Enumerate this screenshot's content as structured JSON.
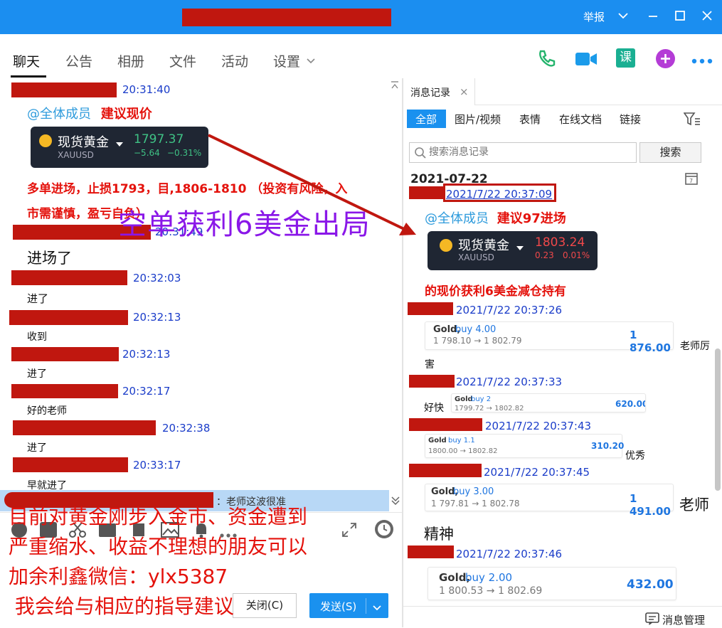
{
  "titlebar": {
    "report": "举报",
    "min": "—",
    "max": "☐",
    "close": "✕"
  },
  "tabs": [
    "聊天",
    "公告",
    "相册",
    "文件",
    "活动",
    "设置"
  ],
  "toolbar_icons": [
    "phone-icon",
    "video-icon",
    "course-icon",
    "add-icon",
    "more-icon"
  ],
  "toolbar_colors": {
    "phone": "#24b46c",
    "video": "#1b9bea",
    "course": "#1aaf92",
    "add": "#b43cd6"
  },
  "chat": {
    "m1_time": "20:31:40",
    "m1_mention": "@全体成员",
    "m1_text": "建议现价",
    "card1": {
      "name": "现货黄金",
      "symbol": "XAUUSD",
      "price": "1797.37",
      "change": "−5.64",
      "pct": "−0.31%"
    },
    "m1_line1": "多单进场，止损1793，目,1806-1810 （投资有风险，入",
    "m1_line2": "市需谨慎，盈亏自负）",
    "m2_time": "20:31:49",
    "m2_text": "进场了",
    "m3_time": "20:32:03",
    "m3_text": "进了",
    "m4_time": "20:32:13",
    "m4_text": "收到",
    "m5_time": "20:32:13",
    "m5_text": "进了",
    "m6_time": "20:32:17",
    "m6_text": "好的老师",
    "m7_time": "20:32:38",
    "m7_text": "进了",
    "m8_time": "20:33:17",
    "m8_text": "早就进了",
    "notice_sep": "：",
    "notice_text": "老师这波很准"
  },
  "overlays": {
    "purple": "空单获利6美金出局",
    "red_line1": "目前对黄金刚步入金市、资金遭到",
    "red_line2": "严重缩水、收益不理想的朋友可以",
    "red_line3": "加余利鑫微信：ylx5387",
    "red_line4": " 我会给与相应的指导建议"
  },
  "compose": {
    "close_btn": "关闭(C)",
    "send_btn": "发送(S)",
    "dropdown": "⌄"
  },
  "history": {
    "tab_title": "消息记录",
    "tab_close": "×",
    "filters": [
      "全部",
      "图片/视频",
      "表情",
      "在线文档",
      "链接"
    ],
    "search_placeholder": "搜索消息记录",
    "search_btn": "搜索",
    "date": "2021-07-22",
    "h1_time": "2021/7/22 20:37:09",
    "h1_mention": "@全体成员",
    "h1_text": "建议97进场",
    "card2": {
      "name": "现货黄金",
      "symbol": "XAUUSD",
      "price": "1803.24",
      "change": "0.23",
      "pct": "0.01%"
    },
    "h1_line": "的现价获利6美金减仓持有",
    "h2_time": "2021/7/22 20:37:26",
    "t1": {
      "gold": "Gold,",
      "buy": "buy 4.00",
      "range": "1 798.10 → 1 802.79",
      "profit": "1 876.00"
    },
    "h2_text_a": "老师厉",
    "h2_text_b": "害",
    "h3_time": "2021/7/22 20:37:33",
    "h3_text": "好快",
    "t2": {
      "gold": "Gold",
      "buy": "buy 2",
      "range": "1799.72 → 1802.82",
      "profit": "620.00"
    },
    "h4_time": "2021/7/22 20:37:43",
    "t3": {
      "gold": "Gold",
      "buy": "buy 1.1",
      "range": "1800.00 → 1802.82",
      "profit": "310.20"
    },
    "h4_text": "优秀",
    "h5_time": "2021/7/22 20:37:45",
    "t4": {
      "gold": "Gold,",
      "buy": "buy 3.00",
      "range": "1 797.81 → 1 802.78",
      "profit": "1 491.00"
    },
    "h5_text": "老师",
    "h5_text_b": "精神",
    "h6_time": "2021/7/22 20:37:46",
    "t5": {
      "gold": "Gold,",
      "buy": "buy 2.00",
      "range": "1 800.53 → 1 802.69",
      "profit": "432.00"
    },
    "manage": "消息管理"
  }
}
